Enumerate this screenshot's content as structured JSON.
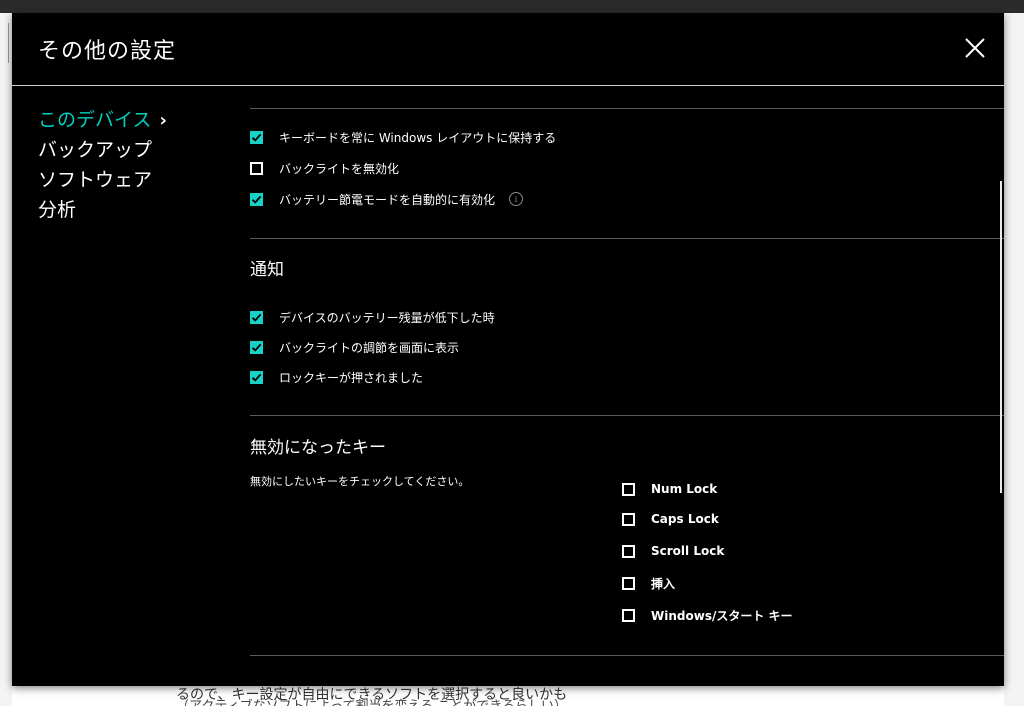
{
  "window": {
    "title": "その他の設定"
  },
  "background": {
    "obscured_text": "（アクティブなソフトによって割当を変える ことができるらしい）",
    "behind_text": "るので、キー設定が自由にできるソフトを選択すると良いかも"
  },
  "sidebar": {
    "items": [
      {
        "label": "このデバイス",
        "active": true
      },
      {
        "label": "バックアップ",
        "active": false
      },
      {
        "label": "ソフトウェア",
        "active": false
      },
      {
        "label": "分析",
        "active": false
      }
    ],
    "chevron": "›"
  },
  "device_options": [
    {
      "label": "キーボードを常に Windows レイアウトに保持する",
      "checked": true
    },
    {
      "label": "バックライトを無効化",
      "checked": false
    },
    {
      "label": "バッテリー節電モードを自動的に有効化",
      "checked": true
    }
  ],
  "info_icon": "i",
  "notifications": {
    "title": "通知",
    "options": [
      {
        "label": "デバイスのバッテリー残量が低下した時",
        "checked": true
      },
      {
        "label": "バックライトの調節を画面に表示",
        "checked": true
      },
      {
        "label": "ロックキーが押されました",
        "checked": true
      }
    ]
  },
  "disabled_keys": {
    "title": "無効になったキー",
    "hint": "無効にしたいキーをチェックしてください。",
    "keys": [
      {
        "label": "Num Lock",
        "checked": false
      },
      {
        "label": "Caps Lock",
        "checked": false
      },
      {
        "label": "Scroll Lock",
        "checked": false
      },
      {
        "label": "挿入",
        "checked": false
      },
      {
        "label": "Windows/スタート キー",
        "checked": false
      }
    ]
  },
  "colors": {
    "accent": "#17d3c7",
    "active_nav": "#00d0c0",
    "dialog_bg": "#000000"
  },
  "icons": {
    "close": "close-icon",
    "check": "checkmark-icon",
    "info": "info-icon",
    "chevron": "chevron-right-icon"
  }
}
